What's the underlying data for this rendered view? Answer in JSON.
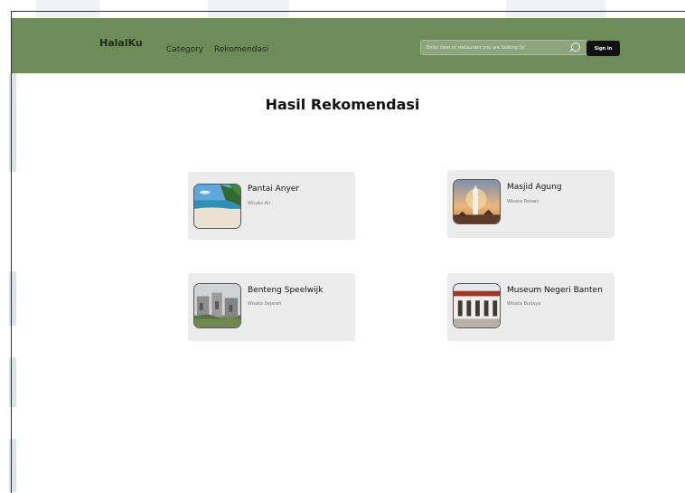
{
  "navbar": {
    "brand": "HalalKu",
    "links": [
      "Category",
      "Rekomendasi"
    ],
    "search_placeholder": "Enter item or restaurant you are looking for",
    "sign_in_label": "Sign In"
  },
  "main": {
    "title": "Hasil Rekomendasi",
    "cards": [
      {
        "title": "Pantai Anyer",
        "subtitle": "Wisata Air"
      },
      {
        "title": "Masjid Agung",
        "subtitle": "Wisata Rohani"
      },
      {
        "title": "Benteng Speelwijk",
        "subtitle": "Wisata Sejarah"
      },
      {
        "title": "Museum Negeri Banten",
        "subtitle": "Wisata Budaya"
      }
    ]
  },
  "colors": {
    "navbar": "#6d8c59",
    "card": "#ebebeb",
    "button": "#111111"
  }
}
